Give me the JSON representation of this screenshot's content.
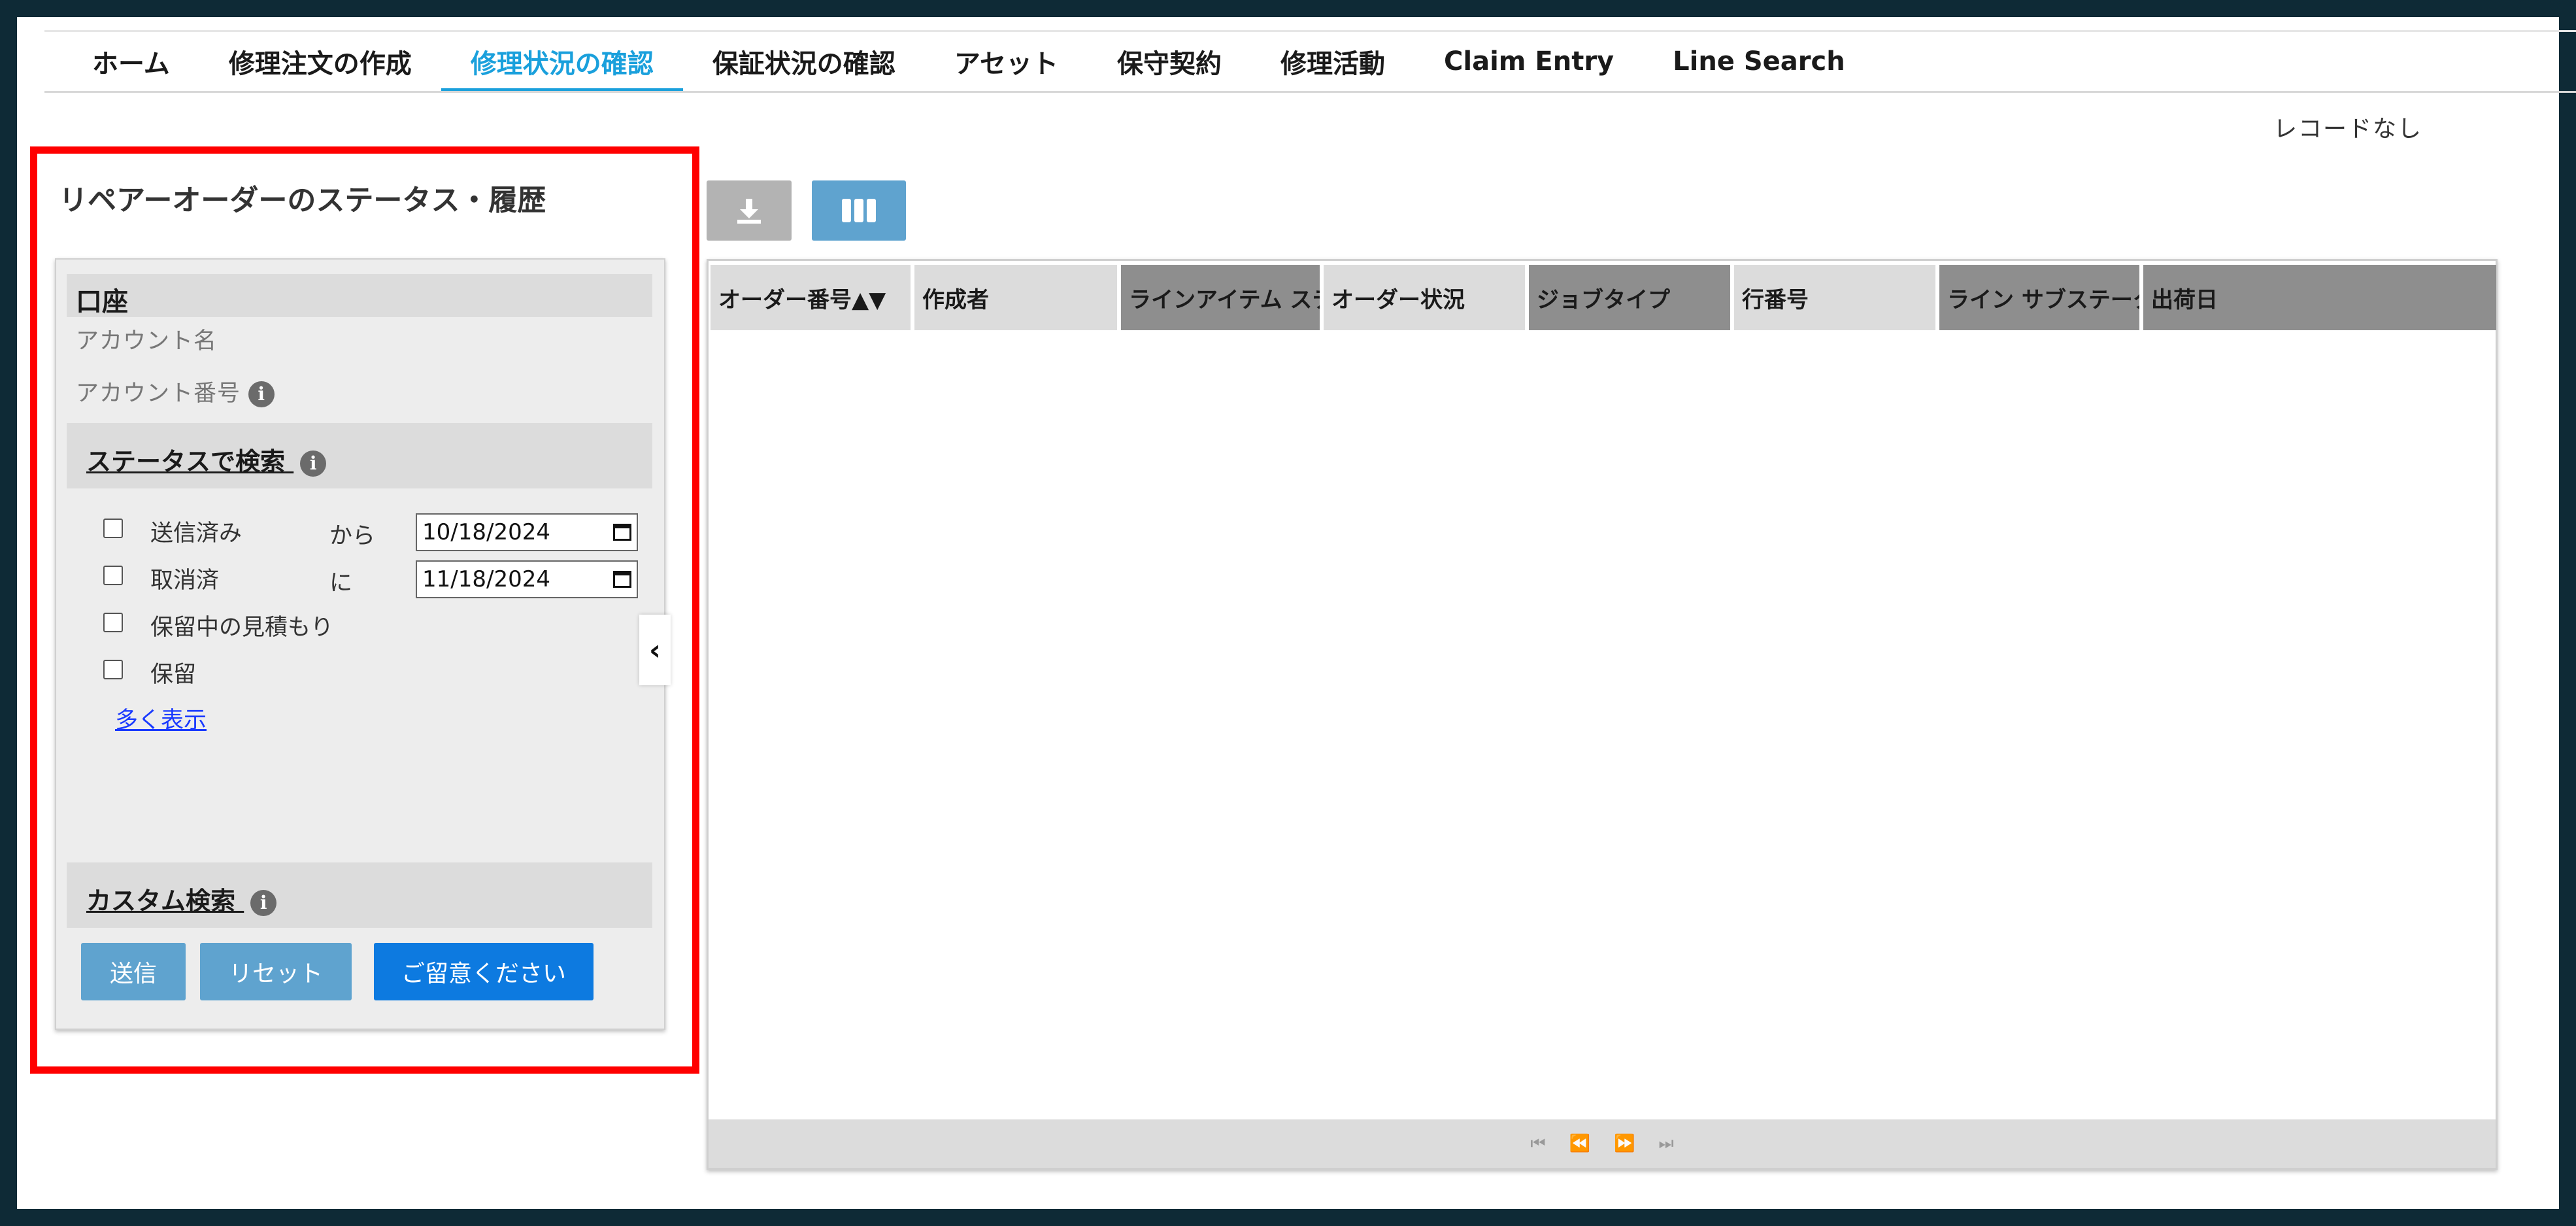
{
  "nav": {
    "items": [
      {
        "label": "ホーム"
      },
      {
        "label": "修理注文の作成"
      },
      {
        "label": "修理状況の確認"
      },
      {
        "label": "保証状況の確認"
      },
      {
        "label": "アセット"
      },
      {
        "label": "保守契約"
      },
      {
        "label": "修理活動"
      },
      {
        "label": "Claim Entry"
      },
      {
        "label": "Line Search"
      }
    ],
    "active": "修理状況の確認"
  },
  "records_status": "レコードなし",
  "panel": {
    "title": "リペアーオーダーのステータス・履歴",
    "account_section": {
      "header": "口座",
      "account_name_label": "アカウント名",
      "account_number_label": "アカウント番号"
    },
    "status_section": {
      "header": "ステータスで検索",
      "checkboxes": [
        {
          "label": "送信済み",
          "checked": false
        },
        {
          "label": "取消済",
          "checked": false
        },
        {
          "label": "保留中の見積もり",
          "checked": false
        },
        {
          "label": "保留",
          "checked": false
        }
      ],
      "from_label": "から",
      "to_label": "に",
      "from_date": "10/18/2024",
      "to_date": "11/18/2024",
      "show_more": "多く表示"
    },
    "custom_section": {
      "header": "カスタム検索"
    },
    "buttons": {
      "submit": "送信",
      "reset": "リセット",
      "notice": "ご留意ください"
    }
  },
  "grid": {
    "columns": [
      {
        "label": "オーダー番号▲▼",
        "style": "light"
      },
      {
        "label": "作成者",
        "style": "light"
      },
      {
        "label": "ラインアイテム ステ",
        "style": "dark"
      },
      {
        "label": "オーダー状況",
        "style": "light"
      },
      {
        "label": "ジョブタイプ",
        "style": "dark"
      },
      {
        "label": "行番号",
        "style": "light"
      },
      {
        "label": "ライン サブステータ",
        "style": "dark"
      },
      {
        "label": "出荷日",
        "style": "dark"
      }
    ],
    "pager": {
      "first_icon": "first-page-icon",
      "prev_icon": "prev-page-icon",
      "next_icon": "next-page-icon",
      "last_icon": "last-page-icon"
    }
  },
  "icons": {
    "info": "info-icon",
    "download": "download-icon",
    "columns": "columns-icon",
    "collapse": "chevron-left-icon",
    "calendar": "calendar-icon"
  },
  "colors": {
    "accent": "#1aa0dc",
    "highlight_border": "#ff0000",
    "primary_button": "#0d7ae0",
    "secondary_button": "#5fa3cf"
  }
}
